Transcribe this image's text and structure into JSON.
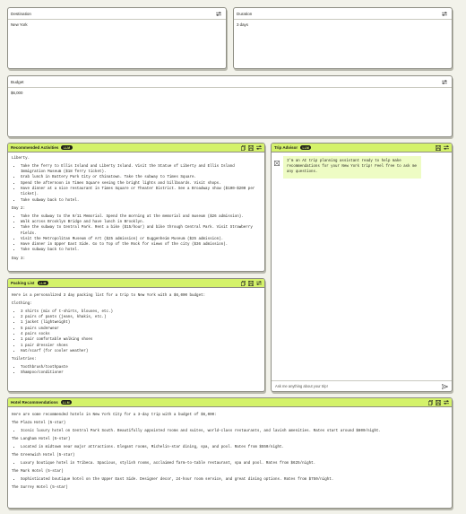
{
  "destination": {
    "label": "Destination",
    "value": "New York"
  },
  "duration": {
    "label": "Duration",
    "value": "3 days"
  },
  "budget": {
    "label": "Budget",
    "value": "$6,000"
  },
  "llm_badge": "LLM",
  "activities": {
    "title": "Recommended Activities",
    "blocks": [
      {
        "type": "p",
        "text": "Liberty."
      },
      {
        "type": "ul",
        "items": [
          "Take the ferry to Ellis Island and Liberty Island. Visit the Statue of Liberty and Ellis Island Immigration Museum ($18 ferry ticket).",
          "Grab lunch in Battery Park City or Chinatown. Take the subway to Times Square.",
          "Spend the afternoon in Times Square seeing the bright lights and billboards. Visit shops.",
          "Have dinner at a nice restaurant in Times Square or Theater District. See a Broadway show ($100-$200 per ticket).",
          "Take subway back to hotel."
        ]
      },
      {
        "type": "p",
        "text": "Day 2:"
      },
      {
        "type": "ul",
        "items": [
          "Take the subway to the 9/11 Memorial. Spend the morning at the memorial and museum ($26 admission).",
          "Walk across Brooklyn Bridge and have lunch in Brooklyn.",
          "Take the subway to Central Park. Rent a bike ($15/hour) and bike through Central Park. Visit Strawberry Fields.",
          "Visit the Metropolitan Museum of Art ($25 admission) or Guggenheim Museum ($25 admission).",
          "Have dinner in Upper East Side. Go to Top of the Rock for views of the city ($36 admission).",
          "Take subway back to hotel."
        ]
      },
      {
        "type": "p",
        "text": "Day 3:"
      }
    ]
  },
  "packing": {
    "title": "Packing List",
    "blocks": [
      {
        "type": "p",
        "text": "Here is a personalized 3 day packing list for a trip to New York with a $6,000 budget:"
      },
      {
        "type": "p",
        "text": "Clothing:"
      },
      {
        "type": "ul",
        "items": [
          "3 shirts (mix of t-shirts, blouses, etc.)",
          "2 pairs of pants (jeans, khakis, etc.)",
          "1 jacket (lightweight)",
          "5 pairs underwear",
          "4 pairs socks",
          "1 pair comfortable walking shoes",
          "1 pair dressier shoes",
          "Hat/scarf (for cooler weather)"
        ]
      },
      {
        "type": "p",
        "text": "Toiletries:"
      },
      {
        "type": "ul",
        "items": [
          "Toothbrush/toothpaste",
          "Shampoo/conditioner"
        ]
      }
    ]
  },
  "advisor": {
    "title": "Trip Advisor",
    "message": "I'm an AI trip planning assistant ready to help make recommendations for your New York trip! Feel free to ask me any questions.",
    "input_placeholder": "Ask me anything about your trip!"
  },
  "hotels": {
    "title": "Hotel Recommendations",
    "blocks": [
      {
        "type": "p",
        "text": "Here are some recommended hotels in New York City for a 3-day trip with a budget of $6,000:"
      },
      {
        "type": "p",
        "text": "The Plaza Hotel (5-star)"
      },
      {
        "type": "ul",
        "items": [
          "Iconic luxury hotel on Central Park South. Beautifully appointed rooms and suites, world-class restaurants, and lavish amenities. Rates start around $800/night."
        ]
      },
      {
        "type": "p",
        "text": "The Langham Hotel (5-star)"
      },
      {
        "type": "ul",
        "items": [
          "Located in midtown near major attractions. Elegant rooms, Michelin-star dining, spa, and pool. Rates from $550/night."
        ]
      },
      {
        "type": "p",
        "text": "The Greenwich Hotel (5-star)"
      },
      {
        "type": "ul",
        "items": [
          "Luxury boutique hotel in Tribeca. Spacious, stylish rooms, acclaimed farm-to-table restaurant, spa and pool. Rates from $625/night."
        ]
      },
      {
        "type": "p",
        "text": "The Mark Hotel (5-star)"
      },
      {
        "type": "ul",
        "items": [
          "Sophisticated boutique hotel on the Upper East Side. Designer decor, 24-hour room service, and great dining options. Rates from $750/night."
        ]
      },
      {
        "type": "p",
        "text": "The Surrey Hotel (5-star)"
      }
    ]
  },
  "colors": {
    "accent": "#d4f26a",
    "bubble": "#eefcc4",
    "badge": "#1f1f1a"
  },
  "icons": {
    "settings": "sliders-icon",
    "copy": "copy-icon",
    "save": "save-icon",
    "chat": "chat-icon",
    "send": "send-icon"
  }
}
